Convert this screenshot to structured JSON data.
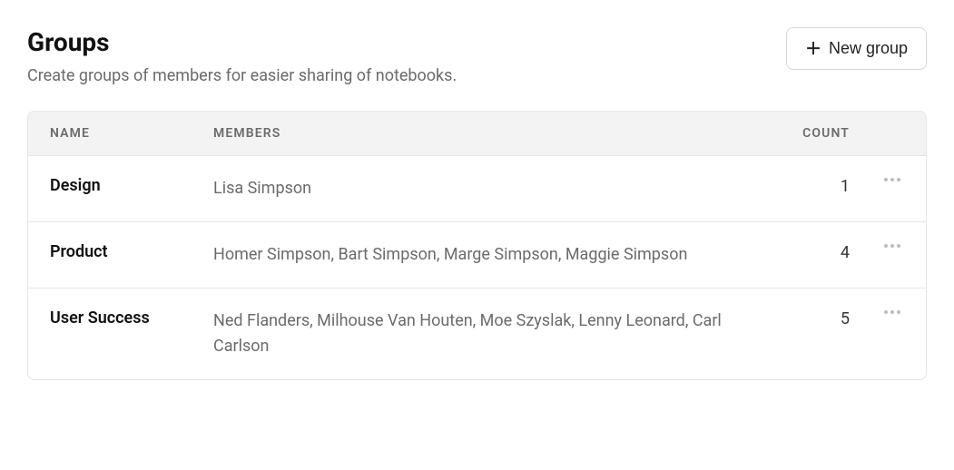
{
  "header": {
    "title": "Groups",
    "subtitle": "Create groups of members for easier sharing of notebooks.",
    "new_group_label": "New group"
  },
  "table": {
    "columns": {
      "name": "NAME",
      "members": "MEMBERS",
      "count": "COUNT"
    },
    "rows": [
      {
        "name": "Design",
        "members": "Lisa Simpson",
        "count": "1"
      },
      {
        "name": "Product",
        "members": "Homer Simpson, Bart Simpson, Marge Simpson, Maggie Simpson",
        "count": "4"
      },
      {
        "name": "User Success",
        "members": "Ned Flanders, Milhouse Van Houten, Moe Szyslak, Lenny Leonard, Carl Carlson",
        "count": "5"
      }
    ]
  }
}
